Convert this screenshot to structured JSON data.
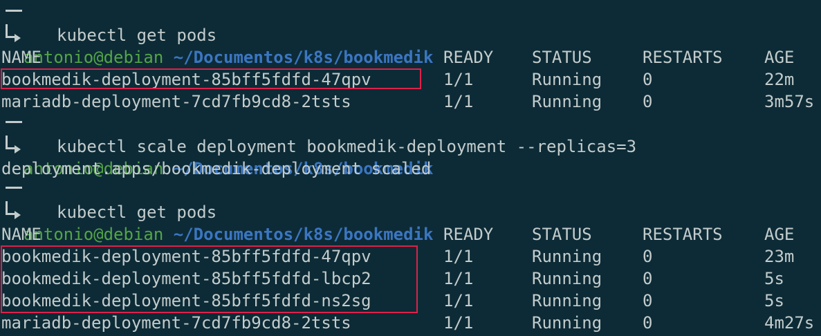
{
  "prompt": {
    "user": "antonio",
    "at": "@",
    "host": "debian",
    "path": "~/Documentos/k8s/bookmedik"
  },
  "headers": {
    "name": "NAME",
    "ready": "READY",
    "status": "STATUS",
    "restarts": "RESTARTS",
    "age": "AGE"
  },
  "block1": {
    "command": "kubectl get pods",
    "rows": [
      {
        "name": "bookmedik-deployment-85bff5fdfd-47qpv",
        "ready": "1/1",
        "status": "Running",
        "restarts": "0",
        "age": "22m"
      },
      {
        "name": "mariadb-deployment-7cd7fb9cd8-2tsts",
        "ready": "1/1",
        "status": "Running",
        "restarts": "0",
        "age": "3m57s"
      }
    ]
  },
  "block2": {
    "command": "kubectl scale deployment bookmedik-deployment --replicas=3",
    "output": "deployment.apps/bookmedik-deployment scaled"
  },
  "block3": {
    "command": "kubectl get pods",
    "rows": [
      {
        "name": "bookmedik-deployment-85bff5fdfd-47qpv",
        "ready": "1/1",
        "status": "Running",
        "restarts": "0",
        "age": "23m"
      },
      {
        "name": "bookmedik-deployment-85bff5fdfd-lbcp2",
        "ready": "1/1",
        "status": "Running",
        "restarts": "0",
        "age": "5s"
      },
      {
        "name": "bookmedik-deployment-85bff5fdfd-ns2sg",
        "ready": "1/1",
        "status": "Running",
        "restarts": "0",
        "age": "5s"
      },
      {
        "name": "mariadb-deployment-7cd7fb9cd8-2tsts",
        "ready": "1/1",
        "status": "Running",
        "restarts": "0",
        "age": "4m27s"
      }
    ]
  },
  "colors": {
    "background": "#0d2b36",
    "text": "#c3cccc",
    "user_green": "#54a447",
    "path_blue": "#3b76c2",
    "highlight_red": "#e0204a"
  }
}
